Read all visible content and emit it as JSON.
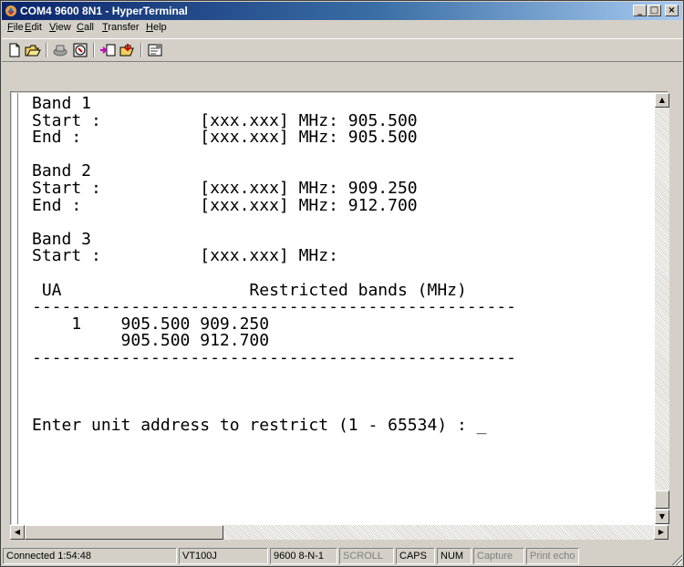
{
  "window": {
    "title": "COM4 9600 8N1 - HyperTerminal"
  },
  "menu": [
    {
      "key": "F",
      "rest": "ile"
    },
    {
      "key": "E",
      "rest": "dit"
    },
    {
      "key": "V",
      "rest": "iew"
    },
    {
      "key": "C",
      "rest": "all"
    },
    {
      "key": "T",
      "rest": "ransfer"
    },
    {
      "key": "H",
      "rest": "elp"
    }
  ],
  "toolbar": {
    "icons": [
      "new-connection-icon",
      "open-icon",
      "disconnect-icon",
      "dial-icon",
      "send-icon",
      "receive-icon",
      "properties-icon"
    ]
  },
  "terminal": {
    "lines": [
      "Band 1",
      "Start :          [xxx.xxx] MHz: 905.500",
      "End :            [xxx.xxx] MHz: 905.500",
      "",
      "Band 2",
      "Start :          [xxx.xxx] MHz: 909.250",
      "End :            [xxx.xxx] MHz: 912.700",
      "",
      "Band 3",
      "Start :          [xxx.xxx] MHz:",
      "",
      " UA                   Restricted bands (MHz)",
      "-------------------------------------------------",
      "    1    905.500 909.250",
      "         905.500 912.700",
      "-------------------------------------------------",
      "",
      "",
      "",
      "Enter unit address to restrict (1 - 65534) : _"
    ]
  },
  "status": {
    "connected": "Connected 1:54:48",
    "emulation": "VT100J",
    "port_settings": "9600 8-N-1",
    "scroll": "SCROLL",
    "caps": "CAPS",
    "num": "NUM",
    "capture": "Capture",
    "print_echo": "Print echo"
  },
  "colors": {
    "title_bar_start": "#0a246a",
    "title_bar_end": "#a6caf0",
    "terminal_bg": "#ffffff",
    "chrome": "#d4d0c8"
  }
}
